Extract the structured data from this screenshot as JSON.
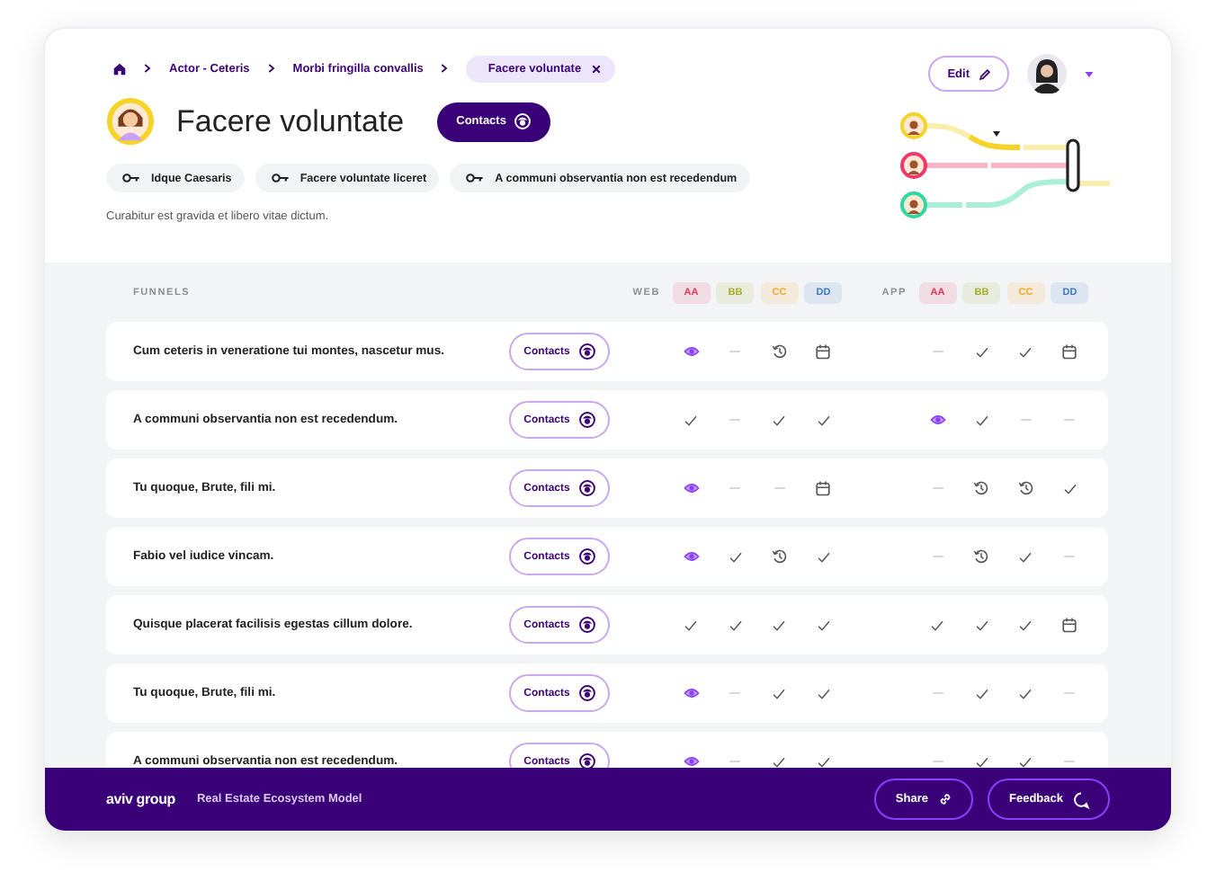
{
  "breadcrumb": {
    "items": [
      "Actor - Ceteris",
      "Morbi fringilla convallis"
    ],
    "current": "Facere voluntate"
  },
  "header": {
    "title": "Facere voluntate",
    "contacts_button": "Contacts",
    "edit_button": "Edit",
    "chips": [
      "Idque Caesaris",
      "Facere voluntate liceret",
      "A communi observantia non est recedendum"
    ],
    "description": "Curabitur est gravida et libero vitae dictum."
  },
  "table": {
    "heading": "FUNNELS",
    "groups": [
      {
        "label": "WEB",
        "tags": [
          {
            "label": "AA",
            "color": "#e8345c"
          },
          {
            "label": "BB",
            "color": "#a3ad2c"
          },
          {
            "label": "CC",
            "color": "#f5a623"
          },
          {
            "label": "DD",
            "color": "#3b78c4"
          }
        ]
      },
      {
        "label": "APP",
        "tags": [
          {
            "label": "AA",
            "color": "#e8345c"
          },
          {
            "label": "BB",
            "color": "#a3ad2c"
          },
          {
            "label": "CC",
            "color": "#f5a623"
          },
          {
            "label": "DD",
            "color": "#3b78c4"
          }
        ]
      }
    ],
    "rows": [
      {
        "text": "Cum ceteris in veneratione tui montes, nascetur mus.",
        "button": "Contacts",
        "web": [
          {
            "kind": "eye"
          },
          {
            "kind": "dash"
          },
          {
            "kind": "history"
          },
          {
            "kind": "calendar"
          }
        ],
        "app": [
          {
            "kind": "dash"
          },
          {
            "kind": "check"
          },
          {
            "kind": "check"
          },
          {
            "kind": "calendar"
          }
        ]
      },
      {
        "text": "A communi observantia non est recedendum.",
        "button": "Contacts",
        "web": [
          {
            "kind": "check"
          },
          {
            "kind": "dash"
          },
          {
            "kind": "check"
          },
          {
            "kind": "check"
          }
        ],
        "app": [
          {
            "kind": "eye"
          },
          {
            "kind": "check"
          },
          {
            "kind": "dash"
          },
          {
            "kind": "dash"
          }
        ]
      },
      {
        "text": "Tu quoque, Brute, fili mi.",
        "button": "Contacts",
        "web": [
          {
            "kind": "eye"
          },
          {
            "kind": "dash"
          },
          {
            "kind": "dash"
          },
          {
            "kind": "calendar"
          }
        ],
        "app": [
          {
            "kind": "dash"
          },
          {
            "kind": "history"
          },
          {
            "kind": "history"
          },
          {
            "kind": "check"
          }
        ]
      },
      {
        "text": "Fabio vel iudice vincam.",
        "button": "Contacts",
        "web": [
          {
            "kind": "eye"
          },
          {
            "kind": "check"
          },
          {
            "kind": "history"
          },
          {
            "kind": "check"
          }
        ],
        "app": [
          {
            "kind": "dash"
          },
          {
            "kind": "history"
          },
          {
            "kind": "check"
          },
          {
            "kind": "dash"
          }
        ]
      },
      {
        "text": "Quisque placerat facilisis egestas cillum dolore.",
        "button": "Contacts",
        "web": [
          {
            "kind": "check"
          },
          {
            "kind": "check"
          },
          {
            "kind": "check"
          },
          {
            "kind": "check"
          }
        ],
        "app": [
          {
            "kind": "check"
          },
          {
            "kind": "check"
          },
          {
            "kind": "check"
          },
          {
            "kind": "calendar"
          }
        ]
      },
      {
        "text": "Tu quoque, Brute, fili mi.",
        "button": "Contacts",
        "web": [
          {
            "kind": "eye"
          },
          {
            "kind": "dash"
          },
          {
            "kind": "check"
          },
          {
            "kind": "check"
          }
        ],
        "app": [
          {
            "kind": "dash"
          },
          {
            "kind": "check"
          },
          {
            "kind": "check"
          },
          {
            "kind": "dash"
          }
        ]
      },
      {
        "text": "A communi observantia non est recedendum.",
        "button": "Contacts",
        "web": [
          {
            "kind": "eye"
          },
          {
            "kind": "dash"
          },
          {
            "kind": "check"
          },
          {
            "kind": "check"
          }
        ],
        "app": [
          {
            "kind": "dash"
          },
          {
            "kind": "check"
          },
          {
            "kind": "check"
          },
          {
            "kind": "dash"
          }
        ]
      }
    ]
  },
  "footer": {
    "logo": "aviv group",
    "title": "Real Estate Ecosystem Model",
    "buttons": [
      {
        "label": "Share",
        "kind": "link"
      },
      {
        "label": "Feedback",
        "kind": "chat"
      }
    ]
  }
}
